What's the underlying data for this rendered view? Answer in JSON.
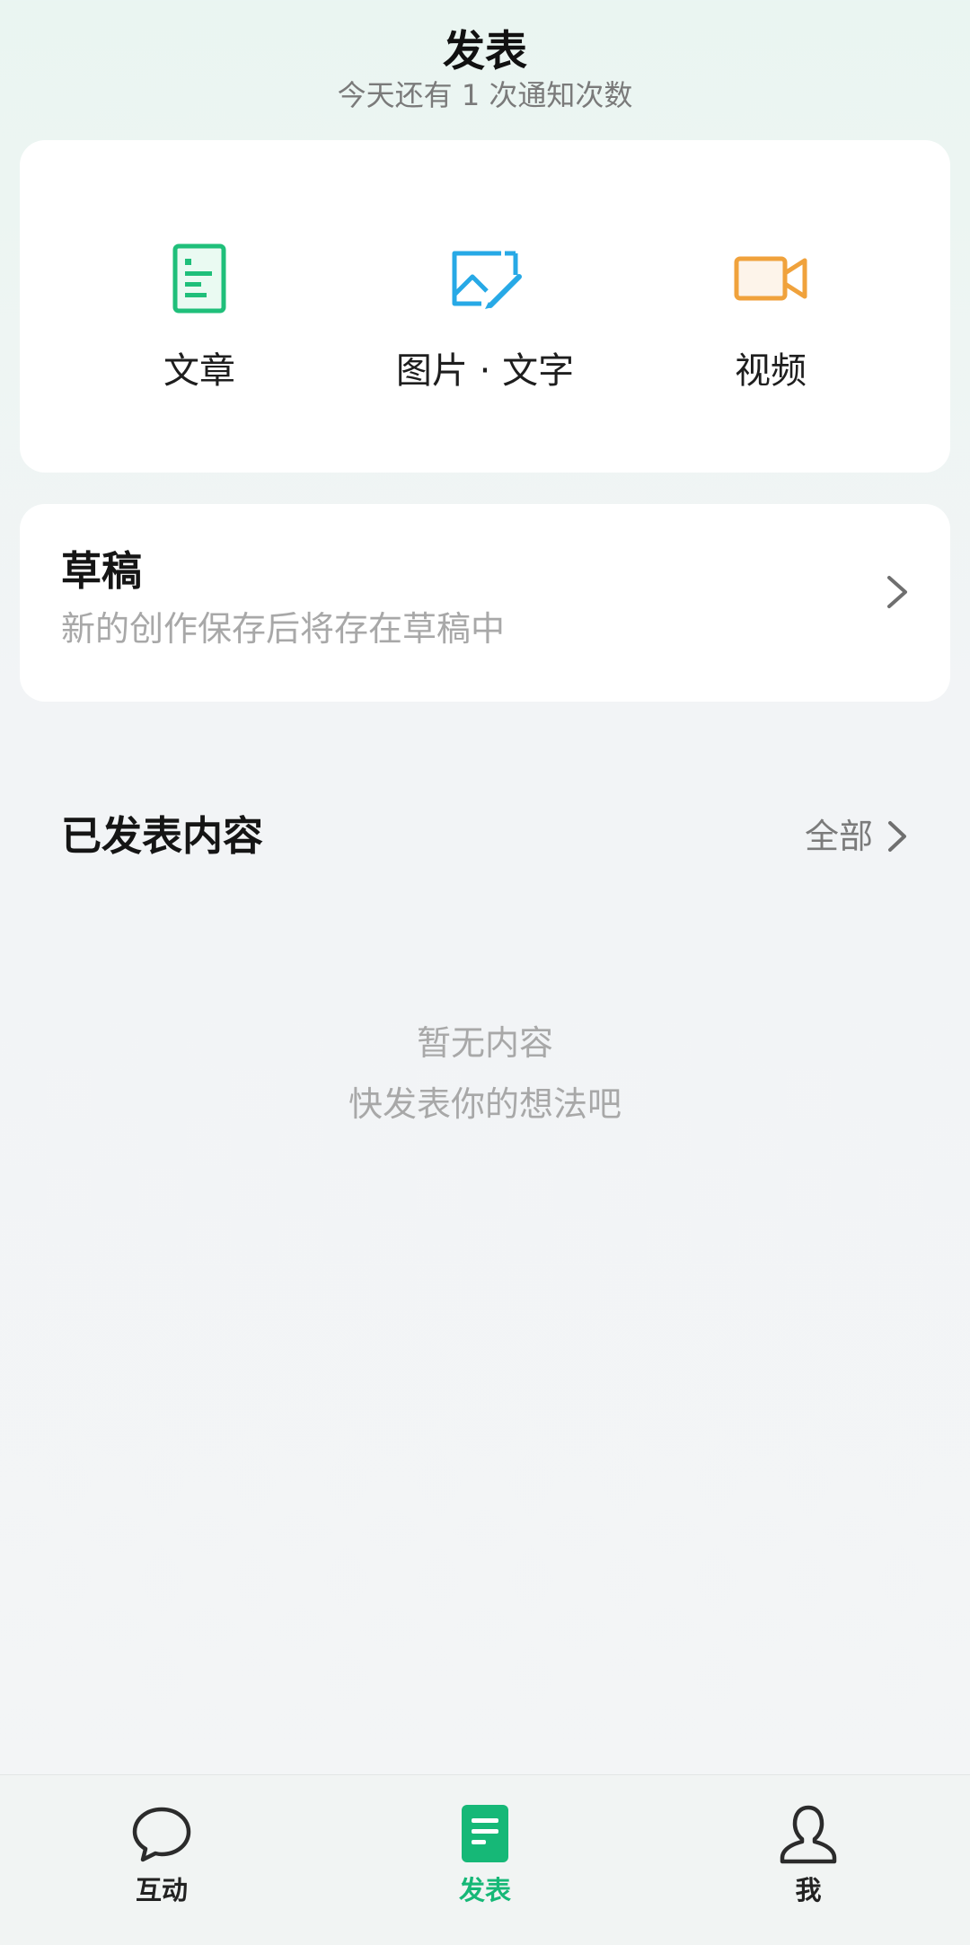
{
  "header": {
    "title": "发表",
    "subtitle": "今天还有 1 次通知次数"
  },
  "create": {
    "items": [
      {
        "label": "文章",
        "icon": "article-icon",
        "color": "#1fbf7a"
      },
      {
        "label": "图片 · 文字",
        "icon": "image-text-icon",
        "color": "#27a9e6"
      },
      {
        "label": "视频",
        "icon": "video-icon",
        "color": "#f0a23c"
      }
    ]
  },
  "draft": {
    "title": "草稿",
    "subtitle": "新的创作保存后将存在草稿中"
  },
  "published": {
    "title": "已发表内容",
    "all_label": "全部",
    "empty_line1": "暂无内容",
    "empty_line2": "快发表你的想法吧"
  },
  "tabbar": {
    "tabs": [
      {
        "label": "互动",
        "icon": "chat-bubble-icon",
        "active": false
      },
      {
        "label": "发表",
        "icon": "document-icon",
        "active": true
      },
      {
        "label": "我",
        "icon": "user-icon",
        "active": false
      }
    ],
    "active_color": "#16b877"
  }
}
